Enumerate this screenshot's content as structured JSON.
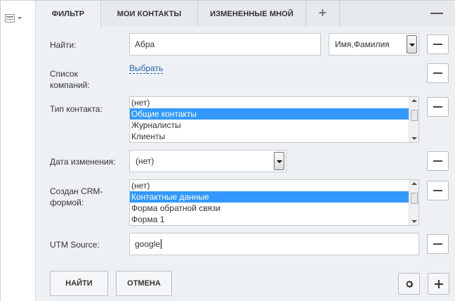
{
  "tabs": {
    "filter": "ФИЛЬТР",
    "my_contacts": "МОИ КОНТАКТЫ",
    "changed_by_me": "ИЗМЕНЕННЫЕ МНОЙ",
    "add": "+"
  },
  "fields": {
    "search": {
      "label": "Найти:",
      "value": "Абра",
      "scope_select": "Имя,Фамилия"
    },
    "companies": {
      "label": "Список компаний:",
      "link": "Выбрать"
    },
    "contact_type": {
      "label": "Тип контакта:",
      "options": [
        "(нет)",
        "Общие контакты",
        "Журналисты",
        "Клиенты"
      ],
      "selected": "Общие контакты"
    },
    "modified_date": {
      "label": "Дата изменения:",
      "value": "(нет)"
    },
    "crm_form": {
      "label": "Создан CRM-формой:",
      "options": [
        "(нет)",
        "Контактные данные",
        "Форма обратной связи",
        "Форма 1"
      ],
      "selected": "Контактные данные"
    },
    "utm_source": {
      "label": "UTM Source:",
      "value": "google"
    }
  },
  "actions": {
    "find": "НАЙТИ",
    "cancel": "ОТМЕНА"
  },
  "icons": {
    "settings": "gear-icon",
    "add": "plus-icon",
    "view": "list-icon"
  }
}
